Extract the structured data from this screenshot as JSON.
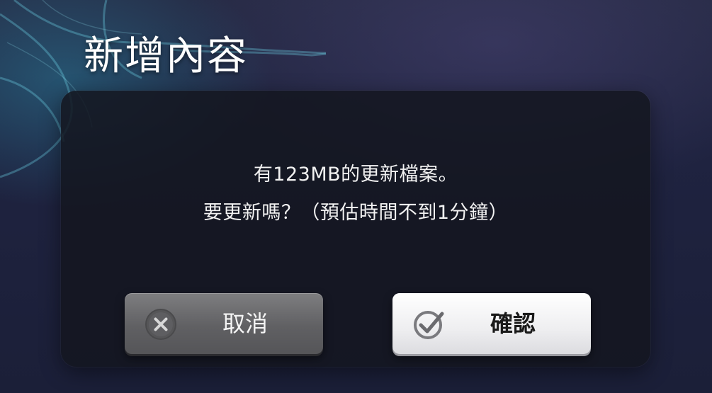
{
  "header": {
    "title": "新增內容"
  },
  "dialog": {
    "message_line1": "有123MB的更新檔案。",
    "message_line2": "要更新嗎？（預估時間不到1分鐘）",
    "cancel": {
      "label": "取消",
      "icon": "x-circle-icon"
    },
    "confirm": {
      "label": "確認",
      "icon": "check-circle-icon"
    }
  },
  "colors": {
    "background": "#1f2340",
    "panel": "#14161f",
    "cancel_button": "#6a6a6d",
    "confirm_button": "#f0f0f2",
    "accent_glow": "#2878a0"
  }
}
